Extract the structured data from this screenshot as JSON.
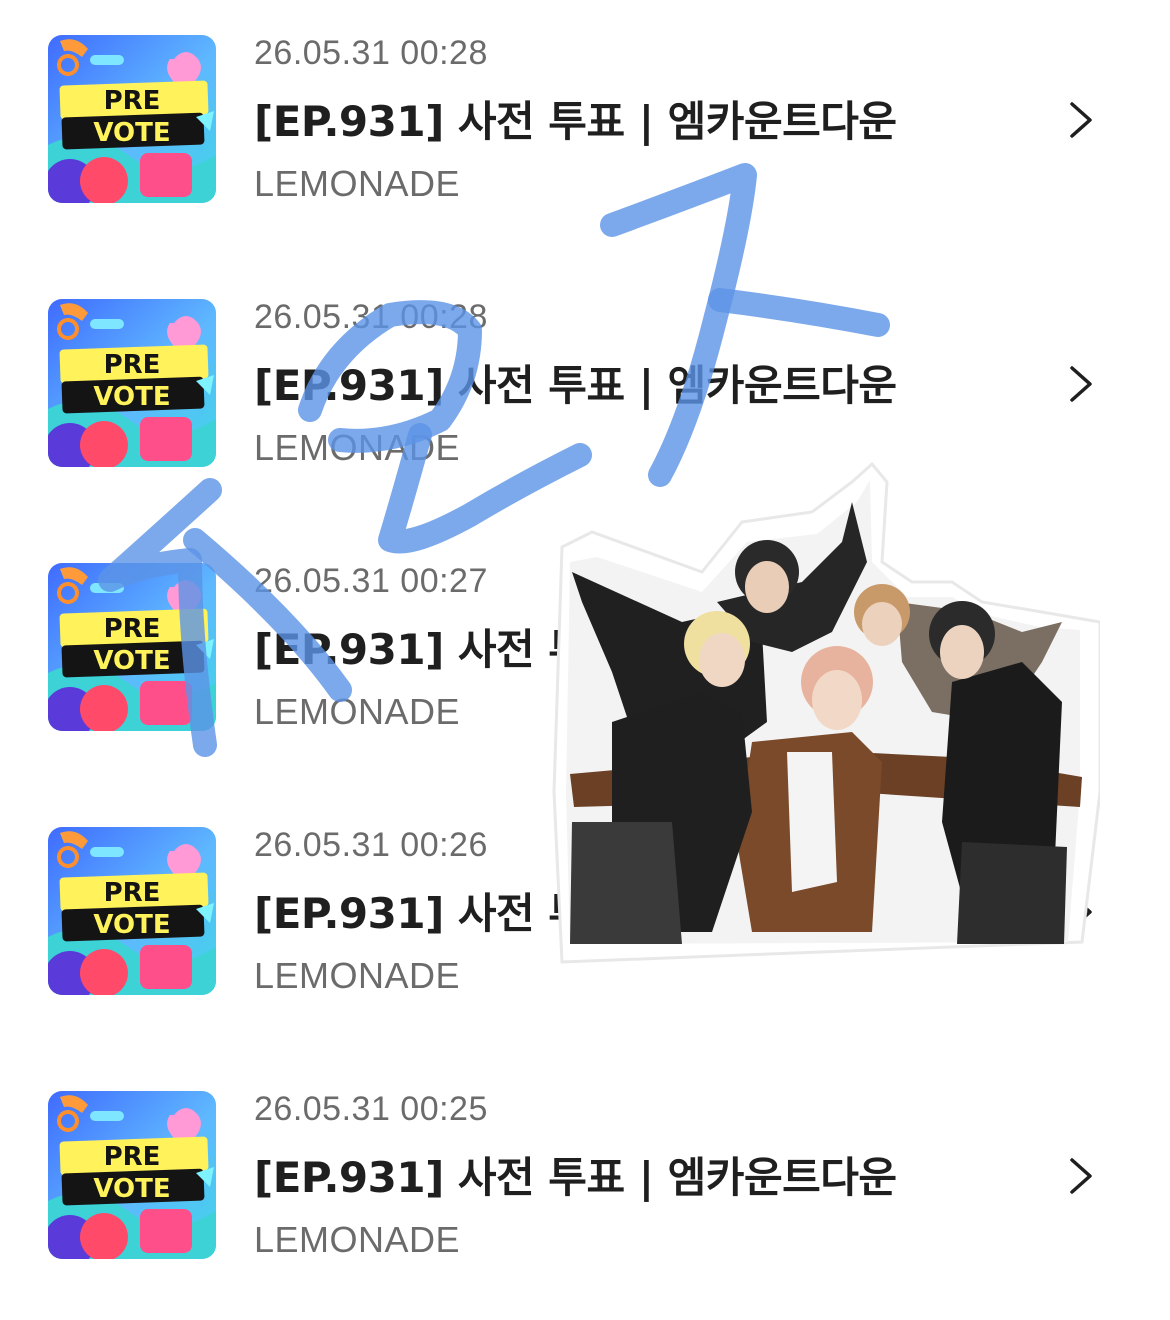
{
  "colors": {
    "text_primary": "#1f1f1f",
    "text_secondary": "#6b6b6b",
    "doodle_stroke": "#5b93e6"
  },
  "thumbnail": {
    "line1": "PRE",
    "line2": "VOTE"
  },
  "items": [
    {
      "timestamp": "26.05.31 00:28",
      "title": "[EP.931] 사전 투표 | 엠카운트다운",
      "channel": "LEMONADE"
    },
    {
      "timestamp": "26.05.31 00:28",
      "title": "[EP.931] 사전 투표 | 엠카운트다운",
      "channel": "LEMONADE"
    },
    {
      "timestamp": "26.05.31 00:27",
      "title": "[EP.931] 사전 투표 | 엠카운트다운",
      "channel": "LEMONADE"
    },
    {
      "timestamp": "26.05.31 00:26",
      "title": "[EP.931] 사전 투표 | 엠카운트다운",
      "channel": "LEMONADE"
    },
    {
      "timestamp": "26.05.31 00:25",
      "title": "[EP.931] 사전 투표 | 엠카운트다운",
      "channel": "LEMONADE"
    }
  ],
  "icons": {
    "row_chevron": "chevron-right-icon",
    "overlay": "group-photo-sticker"
  }
}
